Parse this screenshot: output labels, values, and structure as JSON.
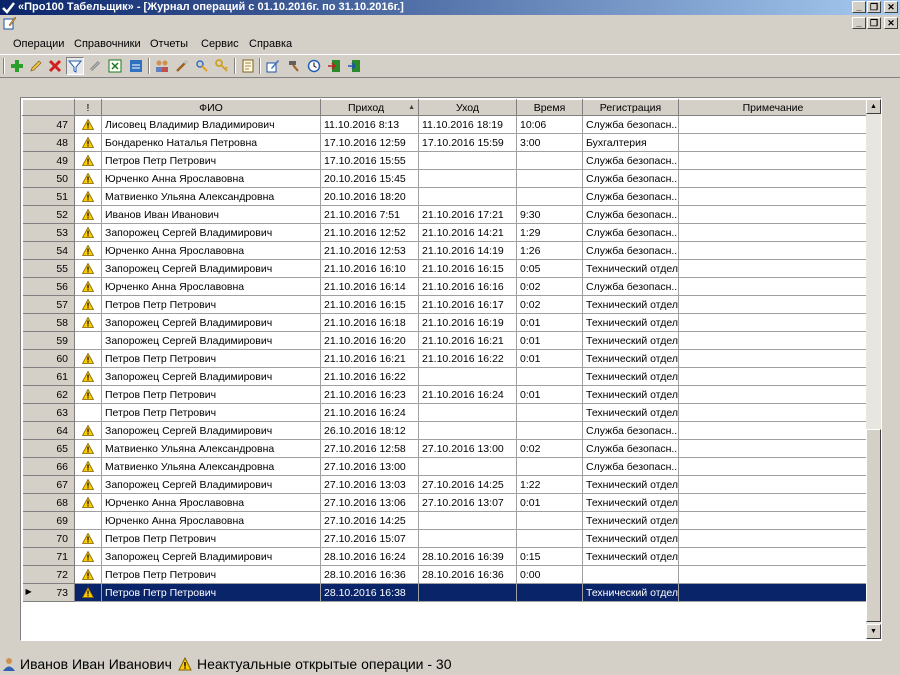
{
  "window": {
    "title": "«Про100 Табельщик» - [Журнал операций с 01.10.2016г. по 31.10.2016г.]",
    "minimize": "_",
    "restore": "❐",
    "close": "✕"
  },
  "menu": {
    "items": [
      "Операции",
      "Справочники",
      "Отчеты",
      "Сервис",
      "Справка"
    ]
  },
  "toolbar": {
    "icons": [
      "add-icon",
      "edit-icon",
      "delete-icon",
      "filter-icon",
      "link-icon",
      "excel-icon",
      "export-icon",
      "people-icon",
      "tools-icon",
      "key-group-icon",
      "key-icon",
      "report-icon",
      "edit-doc-icon",
      "hammer-icon",
      "clock-icon",
      "import-icon",
      "export-doc-icon"
    ]
  },
  "grid": {
    "columns": [
      "",
      "!",
      "ФИО",
      "Приход",
      "Уход",
      "Время",
      "Регистрация",
      "Примечание"
    ],
    "rows": [
      {
        "n": "47",
        "w": true,
        "fio": "Лисовец Владимир Владимирович",
        "in": "11.10.2016 8:13",
        "out": "11.10.2016 18:19",
        "t": "10:06",
        "reg": "Служба безопасн...",
        "note": ""
      },
      {
        "n": "48",
        "w": true,
        "fio": "Бондаренко Наталья Петровна",
        "in": "17.10.2016 12:59",
        "out": "17.10.2016 15:59",
        "t": "3:00",
        "reg": "Бухгалтерия",
        "note": ""
      },
      {
        "n": "49",
        "w": true,
        "fio": "Петров Петр Петрович",
        "in": "17.10.2016 15:55",
        "out": "",
        "t": "",
        "reg": "Служба безопасн...",
        "note": ""
      },
      {
        "n": "50",
        "w": true,
        "fio": "Юрченко Анна Ярославовна",
        "in": "20.10.2016 15:45",
        "out": "",
        "t": "",
        "reg": "Служба безопасн...",
        "note": ""
      },
      {
        "n": "51",
        "w": true,
        "fio": "Матвиенко Ульяна Александровна",
        "in": "20.10.2016 18:20",
        "out": "",
        "t": "",
        "reg": "Служба безопасн...",
        "note": ""
      },
      {
        "n": "52",
        "w": true,
        "fio": "Иванов Иван Иванович",
        "in": "21.10.2016 7:51",
        "out": "21.10.2016 17:21",
        "t": "9:30",
        "reg": "Служба безопасн...",
        "note": ""
      },
      {
        "n": "53",
        "w": true,
        "fio": "Запорожец Сергей Владимирович",
        "in": "21.10.2016 12:52",
        "out": "21.10.2016 14:21",
        "t": "1:29",
        "reg": "Служба безопасн...",
        "note": ""
      },
      {
        "n": "54",
        "w": true,
        "fio": "Юрченко Анна Ярославовна",
        "in": "21.10.2016 12:53",
        "out": "21.10.2016 14:19",
        "t": "1:26",
        "reg": "Служба безопасн...",
        "note": ""
      },
      {
        "n": "55",
        "w": true,
        "fio": "Запорожец Сергей Владимирович",
        "in": "21.10.2016 16:10",
        "out": "21.10.2016 16:15",
        "t": "0:05",
        "reg": "Технический отдел",
        "note": ""
      },
      {
        "n": "56",
        "w": true,
        "fio": "Юрченко Анна Ярославовна",
        "in": "21.10.2016 16:14",
        "out": "21.10.2016 16:16",
        "t": "0:02",
        "reg": "Служба безопасн...",
        "note": ""
      },
      {
        "n": "57",
        "w": true,
        "fio": "Петров Петр Петрович",
        "in": "21.10.2016 16:15",
        "out": "21.10.2016 16:17",
        "t": "0:02",
        "reg": "Технический отдел",
        "note": ""
      },
      {
        "n": "58",
        "w": true,
        "fio": "Запорожец Сергей Владимирович",
        "in": "21.10.2016 16:18",
        "out": "21.10.2016 16:19",
        "t": "0:01",
        "reg": "Технический отдел",
        "note": ""
      },
      {
        "n": "59",
        "w": false,
        "fio": "Запорожец Сергей Владимирович",
        "in": "21.10.2016 16:20",
        "out": "21.10.2016 16:21",
        "t": "0:01",
        "reg": "Технический отдел",
        "note": ""
      },
      {
        "n": "60",
        "w": true,
        "fio": "Петров Петр Петрович",
        "in": "21.10.2016 16:21",
        "out": "21.10.2016 16:22",
        "t": "0:01",
        "reg": "Технический отдел",
        "note": ""
      },
      {
        "n": "61",
        "w": true,
        "fio": "Запорожец Сергей Владимирович",
        "in": "21.10.2016 16:22",
        "out": "",
        "t": "",
        "reg": "Технический отдел",
        "note": ""
      },
      {
        "n": "62",
        "w": true,
        "fio": "Петров Петр Петрович",
        "in": "21.10.2016 16:23",
        "out": "21.10.2016 16:24",
        "t": "0:01",
        "reg": "Технический отдел",
        "note": ""
      },
      {
        "n": "63",
        "w": false,
        "fio": "Петров Петр Петрович",
        "in": "21.10.2016 16:24",
        "out": "",
        "t": "",
        "reg": "Технический отдел",
        "note": ""
      },
      {
        "n": "64",
        "w": true,
        "fio": "Запорожец Сергей Владимирович",
        "in": "26.10.2016 18:12",
        "out": "",
        "t": "",
        "reg": "Служба безопасн...",
        "note": ""
      },
      {
        "n": "65",
        "w": true,
        "fio": "Матвиенко Ульяна Александровна",
        "in": "27.10.2016 12:58",
        "out": "27.10.2016 13:00",
        "t": "0:02",
        "reg": "Служба безопасн...",
        "note": ""
      },
      {
        "n": "66",
        "w": true,
        "fio": "Матвиенко Ульяна Александровна",
        "in": "27.10.2016 13:00",
        "out": "",
        "t": "",
        "reg": "Служба безопасн...",
        "note": ""
      },
      {
        "n": "67",
        "w": true,
        "fio": "Запорожец Сергей Владимирович",
        "in": "27.10.2016 13:03",
        "out": "27.10.2016 14:25",
        "t": "1:22",
        "reg": "Технический отдел",
        "note": ""
      },
      {
        "n": "68",
        "w": true,
        "fio": "Юрченко Анна Ярославовна",
        "in": "27.10.2016 13:06",
        "out": "27.10.2016 13:07",
        "t": "0:01",
        "reg": "Технический отдел",
        "note": ""
      },
      {
        "n": "69",
        "w": false,
        "fio": "Юрченко Анна Ярославовна",
        "in": "27.10.2016 14:25",
        "out": "",
        "t": "",
        "reg": "Технический отдел",
        "note": ""
      },
      {
        "n": "70",
        "w": true,
        "fio": "Петров Петр Петрович",
        "in": "27.10.2016 15:07",
        "out": "",
        "t": "",
        "reg": "Технический отдел",
        "note": ""
      },
      {
        "n": "71",
        "w": true,
        "fio": "Запорожец Сергей Владимирович",
        "in": "28.10.2016 16:24",
        "out": "28.10.2016 16:39",
        "t": "0:15",
        "reg": "Технический отдел",
        "note": ""
      },
      {
        "n": "72",
        "w": true,
        "fio": "Петров Петр Петрович",
        "in": "28.10.2016 16:36",
        "out": "28.10.2016 16:36",
        "t": "0:00",
        "reg": "",
        "note": ""
      },
      {
        "n": "73",
        "w": true,
        "fio": "Петров Петр Петрович",
        "in": "28.10.2016 16:38",
        "out": "",
        "t": "",
        "reg": "Технический отдел",
        "note": "",
        "selected": true
      }
    ]
  },
  "status": {
    "user": "Иванов Иван Иванович",
    "message": "Неактуальные открытые операции - 30"
  },
  "colors": {
    "selection": "#0a246a",
    "title_start": "#0a246a",
    "title_end": "#a6caf0",
    "warning": "#ffcc00"
  }
}
